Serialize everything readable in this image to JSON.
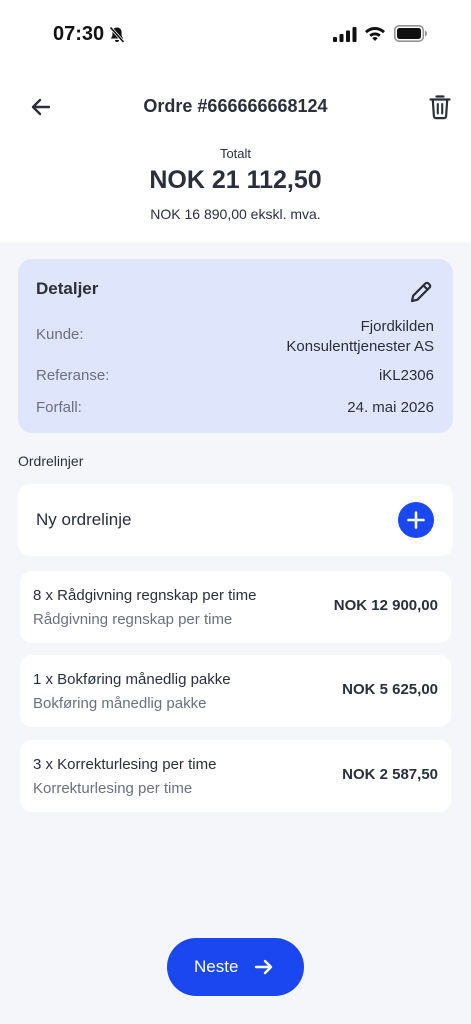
{
  "status_bar": {
    "time": "07:30",
    "icons": [
      "bell-slash-icon",
      "cellular-signal-icon",
      "wifi-icon",
      "battery-icon"
    ]
  },
  "header": {
    "title": "Ordre #666666668124",
    "back_icon": "arrow-left-icon",
    "delete_icon": "trash-icon"
  },
  "totals": {
    "label": "Totalt",
    "amount": "NOK 21 112,50",
    "excl_vat": "NOK 16 890,00 ekskl. mva."
  },
  "details": {
    "title": "Detaljer",
    "edit_icon": "pencil-icon",
    "customer_label": "Kunde:",
    "customer_line1": "Fjordkilden",
    "customer_line2": "Konsulenttjenester AS",
    "reference_label": "Referanse:",
    "reference_value": "iKL2306",
    "due_label": "Forfall:",
    "due_value": "24. mai 2026"
  },
  "order_lines": {
    "section_label": "Ordrelinjer",
    "new_line_label": "Ny ordrelinje",
    "add_icon": "plus-icon",
    "items": [
      {
        "title": "8 x Rådgivning regnskap per time",
        "subtitle": "Rådgivning regnskap per time",
        "amount": "NOK 12 900,00"
      },
      {
        "title": "1 x Bokføring månedlig pakke",
        "subtitle": "Bokføring månedlig pakke",
        "amount": "NOK 5 625,00"
      },
      {
        "title": "3 x Korrekturlesing per time",
        "subtitle": "Korrekturlesing per time",
        "amount": "NOK 2 587,50"
      }
    ]
  },
  "footer": {
    "next_label": "Neste",
    "next_icon": "arrow-right-icon"
  },
  "colors": {
    "accent": "#1a47f0",
    "details_bg": "#dfe5fb",
    "page_bg": "#f5f6fa"
  }
}
